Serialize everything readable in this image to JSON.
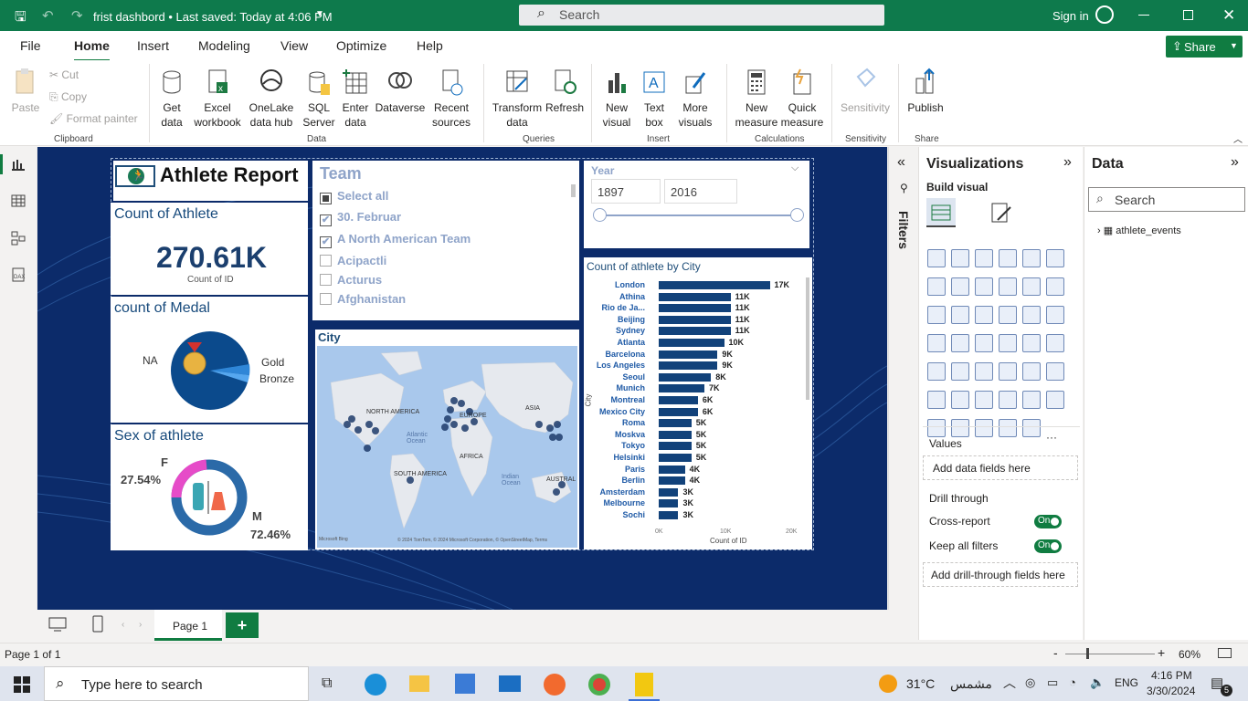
{
  "titlebar": {
    "title": "frist dashbord • Last saved: Today at 4:06 PM",
    "search": "Search",
    "signin": "Sign in"
  },
  "menu": [
    "File",
    "Home",
    "Insert",
    "Modeling",
    "View",
    "Optimize",
    "Help"
  ],
  "share": "Share",
  "ribbon": {
    "clipboard": {
      "paste": "Paste",
      "cut": "Cut",
      "copy": "Copy",
      "format": "Format painter",
      "group": "Clipboard"
    },
    "data": [
      "Get data",
      "Excel workbook",
      "OneLake data hub",
      "SQL Server",
      "Enter data",
      "Dataverse",
      "Recent sources"
    ],
    "data_group": "Data",
    "queries": [
      "Transform data",
      "Refresh"
    ],
    "queries_group": "Queries",
    "insert": [
      "New visual",
      "Text box",
      "More visuals"
    ],
    "insert_group": "Insert",
    "calc": [
      "New measure",
      "Quick measure"
    ],
    "calc_group": "Calculations",
    "sensitivity": "Sensitivity",
    "sensitivity_group": "Sensitivity",
    "publish": "Publish",
    "share_group": "Share"
  },
  "report": {
    "title": "Athlete Report",
    "count_athlete": {
      "title": "Count of Athlete",
      "value": "270.61K",
      "sub": "Count of ID"
    },
    "medal": {
      "title": "count of Medal",
      "labels": [
        "NA",
        "Gold",
        "Bronze"
      ]
    },
    "sex": {
      "title": "Sex of athlete",
      "f_label": "F",
      "f_pct": "27.54%",
      "m_label": "M",
      "m_pct": "72.46%"
    },
    "team": {
      "title": "Team",
      "items": [
        "Select all",
        "30. Februar",
        "A North American Team",
        "Acipactli",
        "Acturus",
        "Afghanistan"
      ]
    },
    "year": {
      "title": "Year",
      "from": "1897",
      "to": "2016"
    },
    "map": {
      "title": "City",
      "labels": [
        "NORTH AMERICA",
        "EUROPE",
        "ASIA",
        "AFRICA",
        "SOUTH AMERICA",
        "Atlantic Ocean",
        "Indian Ocean",
        "AUSTRAL"
      ],
      "credit": "© 2024 TomTom, © 2024 Microsoft Corporation, © OpenStreetMap, Terms",
      "bing": "Microsoft Bing"
    }
  },
  "chart_data": {
    "type": "bar",
    "title": "Count of athlete by City",
    "xlabel": "Count of ID",
    "ylabel": "City",
    "categories": [
      "London",
      "Athina",
      "Rio de Ja...",
      "Beijing",
      "Sydney",
      "Atlanta",
      "Barcelona",
      "Los Angeles",
      "Seoul",
      "Munich",
      "Montreal",
      "Mexico City",
      "Roma",
      "Moskva",
      "Tokyo",
      "Helsinki",
      "Paris",
      "Berlin",
      "Amsterdam",
      "Melbourne",
      "Sochi"
    ],
    "values": [
      17,
      11,
      11,
      11,
      11,
      10,
      9,
      9,
      8,
      7,
      6,
      6,
      5,
      5,
      5,
      5,
      4,
      4,
      3,
      3,
      3
    ],
    "labels": [
      "17K",
      "11K",
      "11K",
      "11K",
      "11K",
      "10K",
      "9K",
      "9K",
      "8K",
      "7K",
      "6K",
      "6K",
      "5K",
      "5K",
      "5K",
      "5K",
      "4K",
      "4K",
      "3K",
      "3K",
      "3K"
    ],
    "ticks": [
      "0K",
      "10K",
      "20K"
    ],
    "xlim": [
      0,
      20
    ],
    "color": "#12427a"
  },
  "filters": "Filters",
  "viz": {
    "title": "Visualizations",
    "build": "Build visual",
    "values": "Values",
    "add_values": "Add data fields here",
    "drill": "Drill through",
    "cross": "Cross-report",
    "keep": "Keep all filters",
    "on": "On",
    "add_drill": "Add drill-through fields here"
  },
  "datapane": {
    "title": "Data",
    "search": "Search",
    "table": "athlete_events"
  },
  "pages": {
    "tab": "Page 1",
    "status": "Page 1 of 1",
    "zoom": "60%"
  },
  "taskbar": {
    "search": "Type here to search",
    "temp": "31°C",
    "weather": "مشمس",
    "lang": "ENG",
    "time": "4:16 PM",
    "date": "3/30/2024",
    "notif": "5"
  }
}
